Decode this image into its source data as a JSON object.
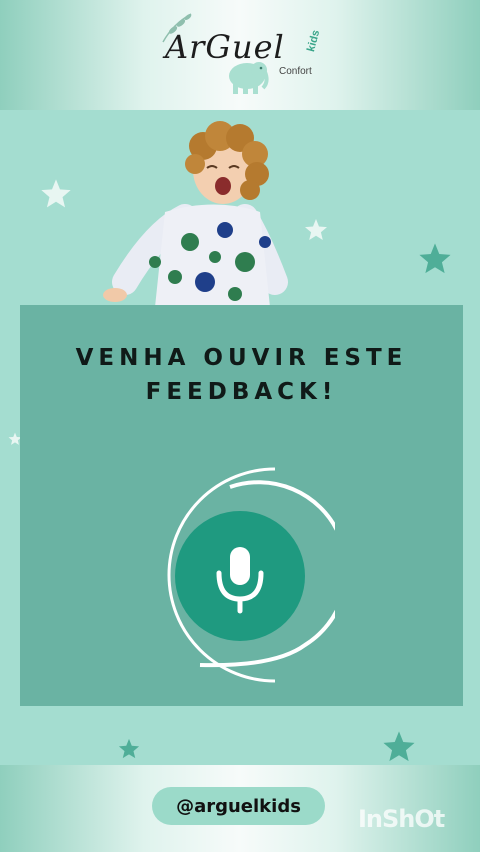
{
  "brand": {
    "logo_main": "ArGuel",
    "logo_kids": "kids",
    "logo_sub": "Confort"
  },
  "card": {
    "title_line1": "VENHA OUVIR ESTE",
    "title_line2": "FEEDBACK!"
  },
  "footer": {
    "handle": "@arguelkids",
    "watermark": "InShOt"
  },
  "colors": {
    "background": "#a4ddd0",
    "card": "#6ab3a3",
    "mic_circle": "#1f9a80",
    "star_dark": "#4fae98",
    "star_light": "#e8f6f2"
  },
  "icons": [
    "leaf-icon",
    "elephant-icon",
    "star-icon",
    "microphone-icon"
  ]
}
